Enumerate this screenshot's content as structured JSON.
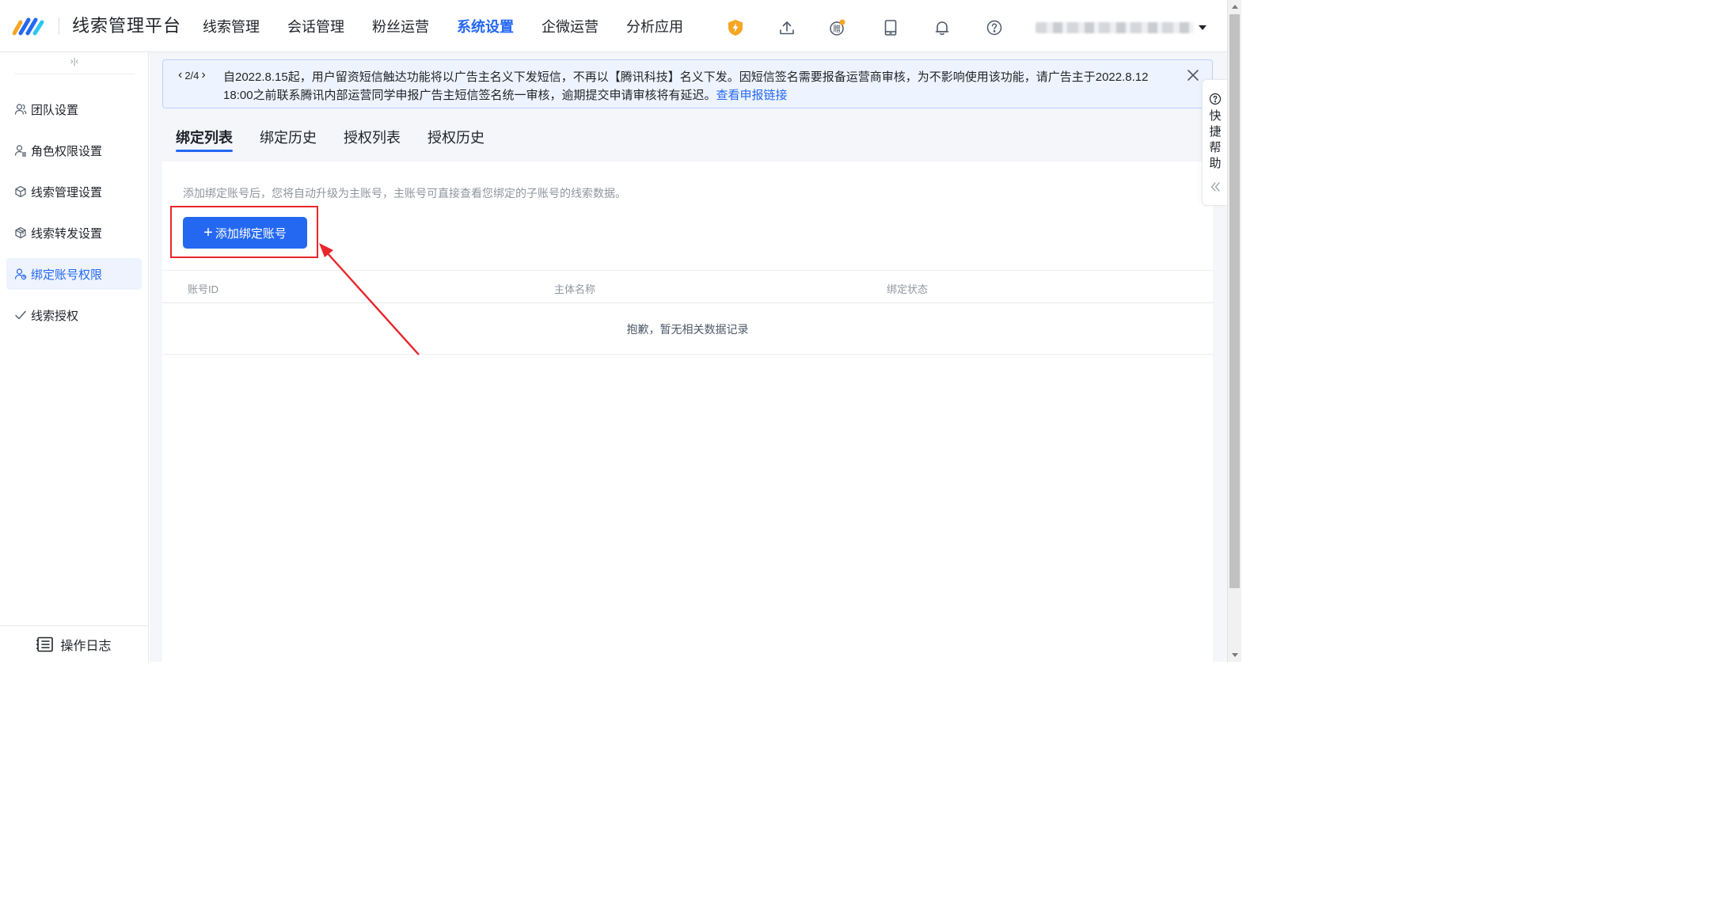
{
  "header": {
    "app_title": "线索管理平台",
    "nav": [
      {
        "label": "线索管理",
        "active": false
      },
      {
        "label": "会话管理",
        "active": false
      },
      {
        "label": "粉丝运营",
        "active": false
      },
      {
        "label": "系统设置",
        "active": true
      },
      {
        "label": "企微运营",
        "active": false
      },
      {
        "label": "分析应用",
        "active": false
      }
    ],
    "icons": [
      "shield-bolt-icon",
      "upload-icon",
      "gift-coin-icon",
      "tablet-icon",
      "bell-icon",
      "help-icon"
    ],
    "coin_icon_text": "赠"
  },
  "sidebar": {
    "collapse_glyph": "›|‹",
    "items": [
      {
        "label": "团队设置",
        "icon": "team-icon",
        "active": false
      },
      {
        "label": "角色权限设置",
        "icon": "role-permission-icon",
        "active": false
      },
      {
        "label": "线索管理设置",
        "icon": "cube-icon",
        "active": false
      },
      {
        "label": "线索转发设置",
        "icon": "cubes-icon",
        "active": false
      },
      {
        "label": "绑定账号权限",
        "icon": "account-bind-icon",
        "active": true
      },
      {
        "label": "线索授权",
        "icon": "check-icon",
        "active": false
      }
    ],
    "footer_label": "操作日志"
  },
  "notice": {
    "pager": "2/4",
    "text": "自2022.8.15起，用户留资短信触达功能将以广告主名义下发短信，不再以【腾讯科技】名义下发。因短信签名需要报备运营商审核，为不影响使用该功能，请广告主于2022.8.12 18:00之前联系腾讯内部运营同学申报广告主短信签名统一审核，逾期提交申请审核将有延迟。",
    "link_text": "查看申报链接"
  },
  "tabs": [
    {
      "label": "绑定列表",
      "active": true
    },
    {
      "label": "绑定历史",
      "active": false
    },
    {
      "label": "授权列表",
      "active": false
    },
    {
      "label": "授权历史",
      "active": false
    }
  ],
  "content": {
    "hint": "添加绑定账号后，您将自动升级为主账号，主账号可直接查看您绑定的子账号的线索数据。",
    "add_button_label": "添加绑定账号",
    "table": {
      "columns": [
        "账号ID",
        "主体名称",
        "绑定状态"
      ],
      "empty_text": "抱歉，暂无相关数据记录"
    }
  },
  "help_tab": {
    "label": "快捷帮助"
  },
  "colors": {
    "primary": "#2468f2",
    "annotation_red": "#e8262b",
    "notice_bg": "#eef4ff",
    "shield": "#f5a623"
  }
}
